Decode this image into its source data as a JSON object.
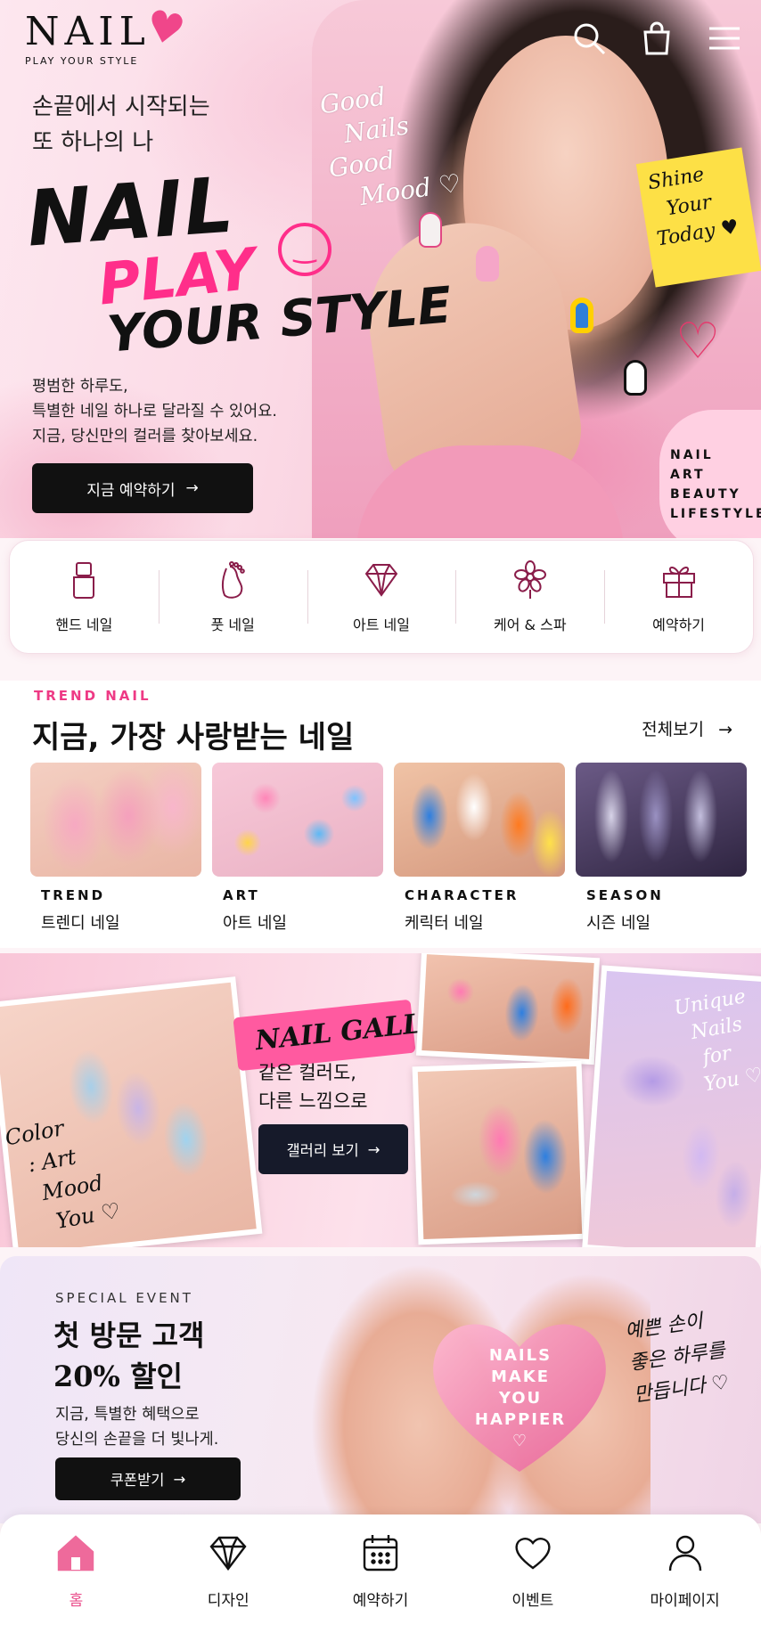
{
  "brand": {
    "name": "NAIL",
    "tagline": "PLAY YOUR STYLE"
  },
  "header": {
    "icons": [
      "search-icon",
      "shopping-bag-icon",
      "menu-icon"
    ]
  },
  "hero": {
    "subtitle_line1": "손끝에서 시작되는",
    "subtitle_line2": "또 하나의 나",
    "big_line1": "NAIL",
    "big_line2": "PLAY",
    "big_line3": "YOUR STYLE",
    "desc_line1": "평범한 하루도,",
    "desc_line2": "특별한 네일 하나로 달라질 수 있어요.",
    "desc_line3": "지금, 당신만의 컬러를 찾아보세요.",
    "cta_label": "지금 예약하기",
    "cta_arrow": "→",
    "script_line1": "Good",
    "script_line2": "Nails",
    "script_line3": "Good",
    "script_line4": "Mood ♡",
    "note_line1": "Shine",
    "note_line2": "Your",
    "note_line3": "Today ♥",
    "lifestyle_line1": "NAIL",
    "lifestyle_line2": "ART",
    "lifestyle_line3": "BEAUTY",
    "lifestyle_line4": "LIFESTYLE"
  },
  "categories": [
    {
      "label": "핸드 네일",
      "icon": "nail-polish-icon"
    },
    {
      "label": "풋 네일",
      "icon": "foot-icon"
    },
    {
      "label": "아트 네일",
      "icon": "diamond-icon"
    },
    {
      "label": "케어 & 스파",
      "icon": "flower-icon"
    },
    {
      "label": "예약하기",
      "icon": "gift-icon"
    }
  ],
  "trend": {
    "tag": "TREND NAIL",
    "title": "지금, 가장 사랑받는 네일",
    "more_label": "전체보기",
    "more_arrow": "→",
    "cards": [
      {
        "category": "TREND",
        "name": "트렌디 네일"
      },
      {
        "category": "ART",
        "name": "아트 네일"
      },
      {
        "category": "CHARACTER",
        "name": "케릭터 네일"
      },
      {
        "category": "SEASON",
        "name": "시즌 네일"
      }
    ]
  },
  "gallery": {
    "logo": "NAIL GALLERY",
    "text_line1": "같은 컬러도,",
    "text_line2": "다른 느낌으로",
    "button_label": "갤러리 보기",
    "button_arrow": "→",
    "script_left_line1": "Color",
    "script_left_line2": ": Art",
    "script_left_line3": "Mood",
    "script_left_line4": "You ♡",
    "script_right_line1": "Unique",
    "script_right_line2": "Nails",
    "script_right_line3": "for",
    "script_right_line4": "You ♡"
  },
  "event": {
    "tag": "SPECIAL EVENT",
    "title_line1": "첫 방문 고객",
    "title_line2": "20% 할인",
    "desc_line1": "지금, 특별한 혜택으로",
    "desc_line2": "당신의 손끝을 더 빛나게.",
    "button_label": "쿠폰받기",
    "button_arrow": "→",
    "heart_line1": "NAILS",
    "heart_line2": "MAKE",
    "heart_line3": "YOU",
    "heart_line4": "HAPPIER",
    "heart_line5": "♡",
    "script_line1": "예쁜 손이",
    "script_line2": "좋은 하루를",
    "script_line3": "만듭니다 ♡"
  },
  "bottom_nav": [
    {
      "label": "홈",
      "icon": "home-icon",
      "active": true
    },
    {
      "label": "디자인",
      "icon": "diamond-icon",
      "active": false
    },
    {
      "label": "예약하기",
      "icon": "calendar-icon",
      "active": false
    },
    {
      "label": "이벤트",
      "icon": "heart-icon",
      "active": false
    },
    {
      "label": "마이페이지",
      "icon": "user-icon",
      "active": false
    }
  ],
  "colors": {
    "accent_pink": "#ee3a85",
    "nav_active": "#ea4f8c",
    "dark_button": "#111111"
  }
}
